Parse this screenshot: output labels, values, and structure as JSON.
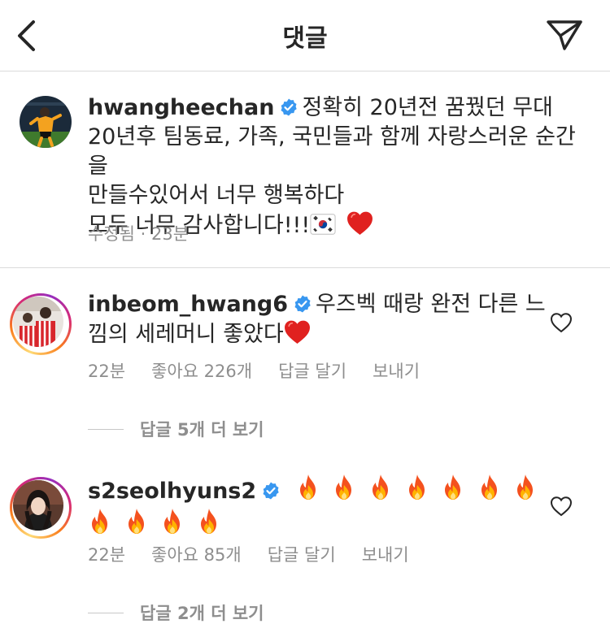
{
  "header": {
    "title": "댓글",
    "back_icon": "chevron-left-icon",
    "send_icon": "paper-plane-icon"
  },
  "caption": {
    "username": "hwangheechan",
    "lines": [
      "정확히 20년전 꿈꿨던 무대",
      "20년후 팀동료, 가족, 국민들과 함께 자랑스러운 순간을",
      "만들수있어서 너무 행복하다",
      "모두 너무 감사합니다!!!"
    ],
    "meta": "수정됨 · 23분"
  },
  "comments": [
    {
      "username": "inbeom_hwang6",
      "text_line1": "우즈벡 때랑 완전 다른 느",
      "text_line2": "낌의 세레머니 좋았다",
      "time": "22분",
      "likes": "좋아요 226개",
      "reply": "답글 달기",
      "send": "보내기",
      "view_replies": "답글 5개 더 보기"
    },
    {
      "username": "s2seolhyuns2",
      "time": "22분",
      "likes": "좋아요 85개",
      "reply": "답글 달기",
      "send": "보내기",
      "view_replies": "답글 2개 더 보기"
    }
  ],
  "colors": {
    "text": "#262626",
    "secondary": "#8e8e8e",
    "verified": "#3897f0",
    "divider": "#dbdbdb",
    "heart": "#e0211f"
  }
}
